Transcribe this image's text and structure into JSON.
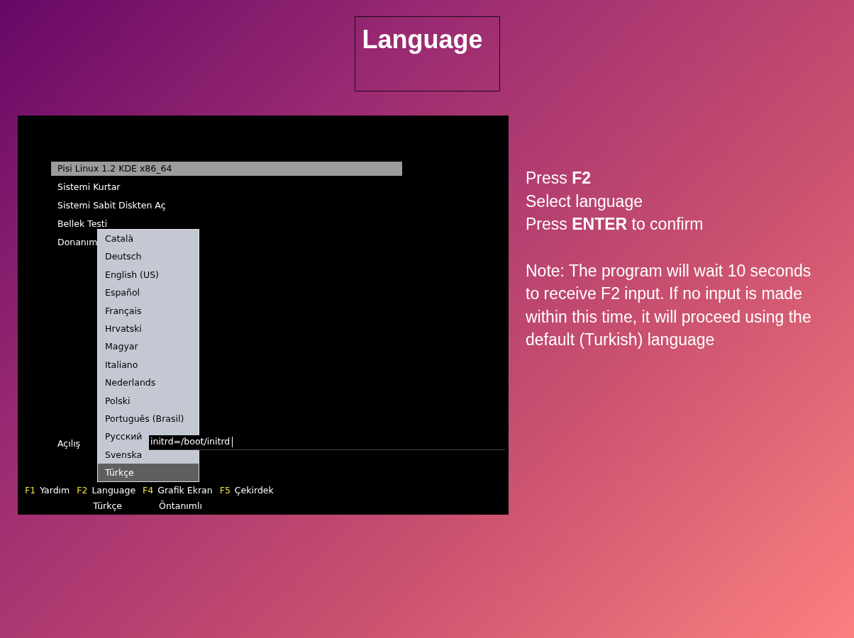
{
  "title": "Language",
  "boot_screen": {
    "menu": [
      {
        "label": "Pisi Linux 1.2 KDE x86_64",
        "selected": true
      },
      {
        "label": "Sistemi Kurtar",
        "selected": false
      },
      {
        "label": "Sistemi Sabit Diskten Aç",
        "selected": false
      },
      {
        "label": "Bellek Testi",
        "selected": false
      },
      {
        "label": "Donanım",
        "selected": false
      }
    ],
    "boot_options": {
      "label": "Açılış",
      "value": "initrd=/boot/initrd"
    },
    "language_menu": [
      {
        "label": "Català",
        "selected": false
      },
      {
        "label": "Deutsch",
        "selected": false
      },
      {
        "label": "English (US)",
        "selected": false
      },
      {
        "label": "Español",
        "selected": false
      },
      {
        "label": "Français",
        "selected": false
      },
      {
        "label": "Hrvatski",
        "selected": false
      },
      {
        "label": "Magyar",
        "selected": false
      },
      {
        "label": "Italiano",
        "selected": false
      },
      {
        "label": "Nederlands",
        "selected": false
      },
      {
        "label": "Polski",
        "selected": false
      },
      {
        "label": "Português (Brasil)",
        "selected": false
      },
      {
        "label": "Русский",
        "selected": false
      },
      {
        "label": "Svenska",
        "selected": false
      },
      {
        "label": "Türkçe",
        "selected": true
      }
    ],
    "function_keys": [
      {
        "key": "F1",
        "label": "Yardım"
      },
      {
        "key": "F2",
        "label": "Language",
        "value": "Türkçe"
      },
      {
        "key": "F4",
        "label": "Grafik Ekran",
        "value": "Öntanımlı"
      },
      {
        "key": "F5",
        "label": "Çekirdek"
      }
    ]
  },
  "instructions": [
    "Press **F2**",
    "Select language",
    "Press **ENTER** to confirm"
  ],
  "note": "Note: The program will wait 10 seconds to receive F2 input. If no input is made within this time, it will proceed using the default (Turkish) language"
}
